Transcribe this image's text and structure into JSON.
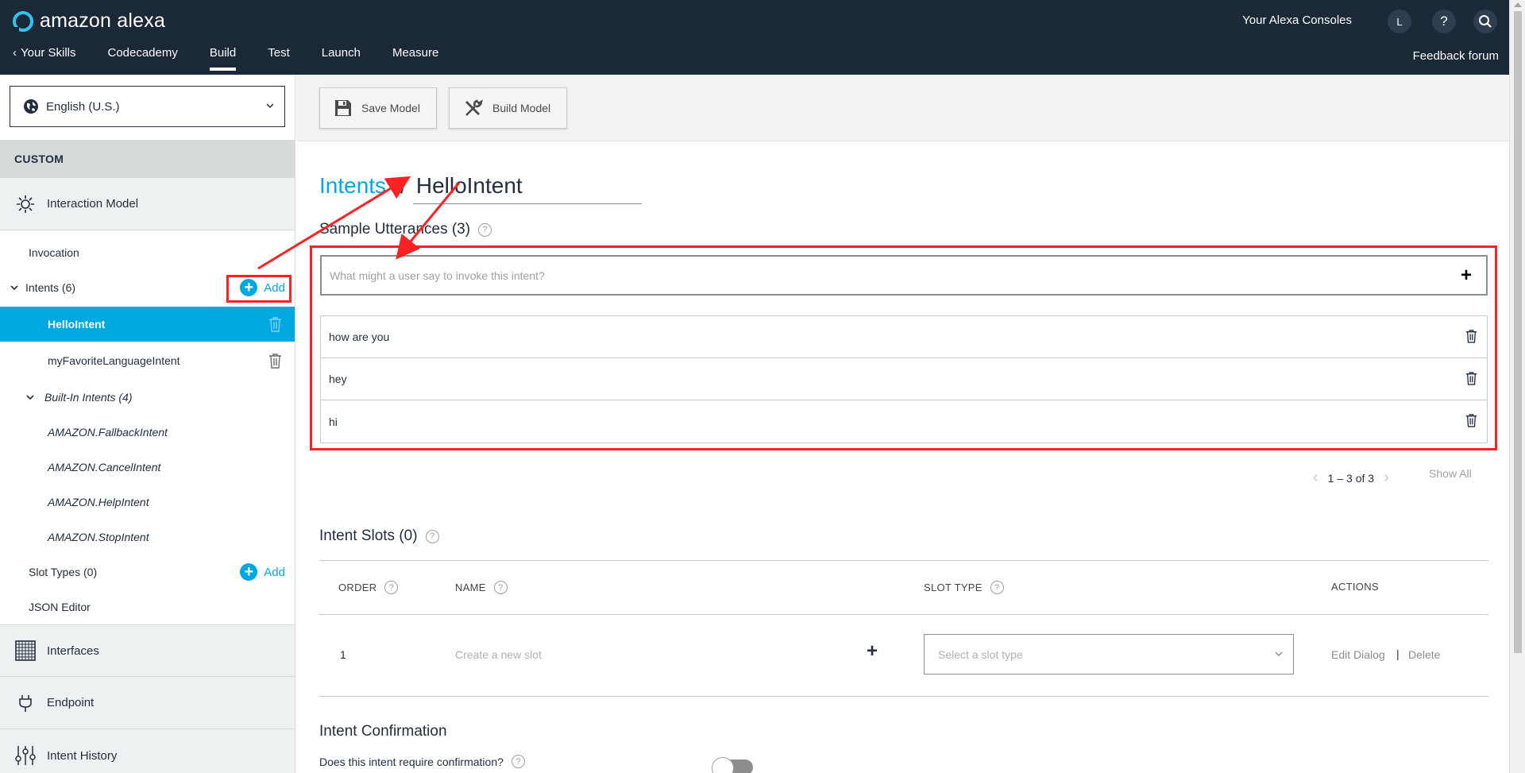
{
  "header": {
    "brand": "amazon alexa",
    "nav": [
      {
        "label": "Your Skills",
        "active": false
      },
      {
        "label": "Codecademy",
        "active": false
      },
      {
        "label": "Build",
        "active": true
      },
      {
        "label": "Test",
        "active": false
      },
      {
        "label": "Launch",
        "active": false
      },
      {
        "label": "Measure",
        "active": false
      }
    ],
    "consoles_label": "Your Alexa Consoles",
    "avatar_initial": "L",
    "help_label": "?",
    "feedback_label": "Feedback forum"
  },
  "sidebar": {
    "language": "English (U.S.)",
    "custom_label": "CUSTOM",
    "interaction_model": "Interaction Model",
    "invocation": "Invocation",
    "intents_label": "Intents (6)",
    "add_label": "Add",
    "intents": [
      "HelloIntent",
      "myFavoriteLanguageIntent"
    ],
    "builtin_label": "Built-In Intents (4)",
    "builtin_intents": [
      "AMAZON.FallbackIntent",
      "AMAZON.CancelIntent",
      "AMAZON.HelpIntent",
      "AMAZON.StopIntent"
    ],
    "slot_types_label": "Slot Types (0)",
    "json_editor": "JSON Editor",
    "interfaces": "Interfaces",
    "endpoint": "Endpoint",
    "intent_history": "Intent History"
  },
  "toolbar": {
    "save_model": "Save Model",
    "build_model": "Build Model"
  },
  "main": {
    "breadcrumb_link": "Intents",
    "breadcrumb_sep": "/",
    "intent_name": "HelloIntent",
    "sample_utterances_title": "Sample Utterances (3)",
    "utterance_placeholder": "What might a user say to invoke this intent?",
    "utterances": [
      "how are you",
      "hey",
      "hi"
    ],
    "pager_text": "1 – 3 of 3",
    "show_all": "Show All",
    "intent_slots_title": "Intent Slots (0)",
    "columns": {
      "order": "ORDER",
      "name": "NAME",
      "slot_type": "SLOT TYPE",
      "actions": "ACTIONS"
    },
    "slot_row": {
      "order": "1",
      "name_placeholder": "Create a new slot",
      "slot_type_placeholder": "Select a slot type",
      "edit_dialog": "Edit Dialog",
      "separator": "|",
      "delete": "Delete"
    },
    "confirmation_title": "Intent Confirmation",
    "confirmation_question": "Does this intent require confirmation?"
  },
  "colors": {
    "header_bg": "#1b2838",
    "accent": "#00a8e1",
    "annotation": "#ff2222"
  }
}
